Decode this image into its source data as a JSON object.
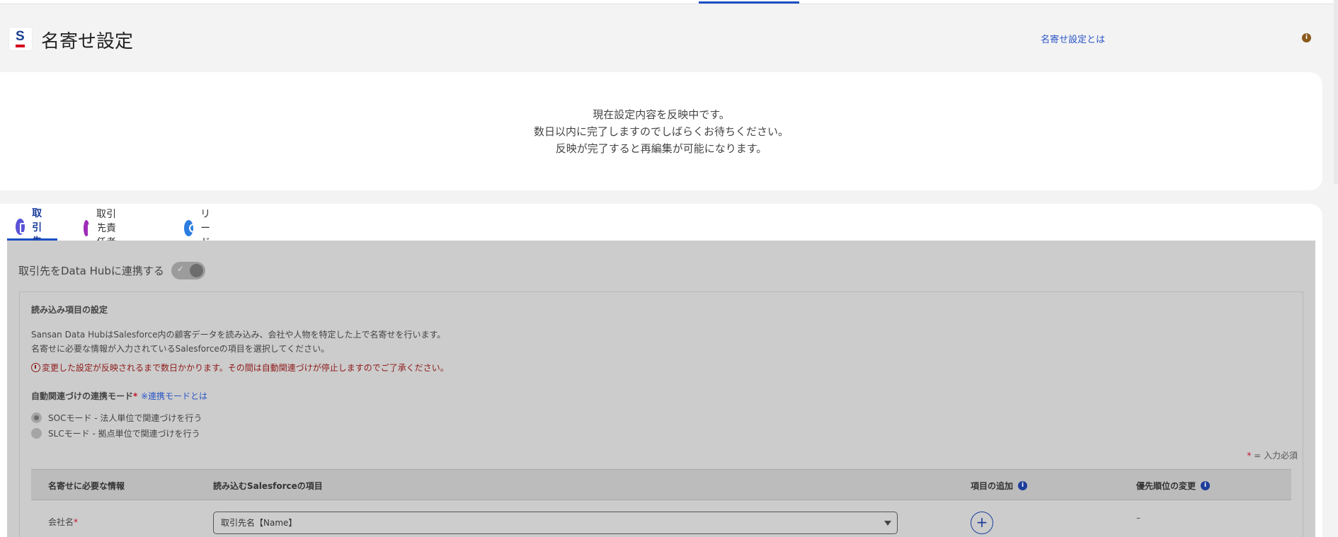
{
  "header": {
    "title": "名寄せ設定",
    "help_link": "名寄せ設定とは",
    "help_icon": "i"
  },
  "notice": {
    "line1": "現在設定内容を反映中です。",
    "line2": "数日以内に完了しますのでしばらくお待ちください。",
    "line3": "反映が完了すると再編集が可能になります。"
  },
  "tabs": [
    {
      "label": "取引先",
      "icon": "building-icon",
      "active": true
    },
    {
      "label": "取引先責任者",
      "icon": "contact-card-icon",
      "active": false
    },
    {
      "label": "リード",
      "icon": "person-icon",
      "active": false
    }
  ],
  "toggle": {
    "label": "取引先をData Hubに連携する",
    "check": "✓"
  },
  "settings": {
    "title": "読み込み項目の設定",
    "desc1": "Sansan Data HubはSalesforce内の顧客データを読み込み、会社や人物を特定した上で名寄せを行います。",
    "desc2": "名寄せに必要な情報が入力されているSalesforceの項目を選択してください。",
    "warning": "変更した設定が反映されるまで数日かかります。その間は自動関連づけが停止しますのでご了承ください。",
    "mode_label": "自動関連づけの連携モード",
    "mode_required": "*",
    "mode_link": "※連携モードとは",
    "radio1": "SOCモード - 法人単位で関連づけを行う",
    "radio2": "SLCモード - 拠点単位で関連づけを行う",
    "required_note_star": "*",
    "required_note": " = 入力必須"
  },
  "table": {
    "headers": [
      "名寄せに必要な情報",
      "読み込むSalesforceの項目",
      "項目の追加",
      "優先順位の変更"
    ],
    "info_icon": "i",
    "rows": [
      {
        "name": "会社名",
        "required": "*",
        "field": "取引先名【Name】",
        "add": "+",
        "priority": "–"
      }
    ]
  }
}
